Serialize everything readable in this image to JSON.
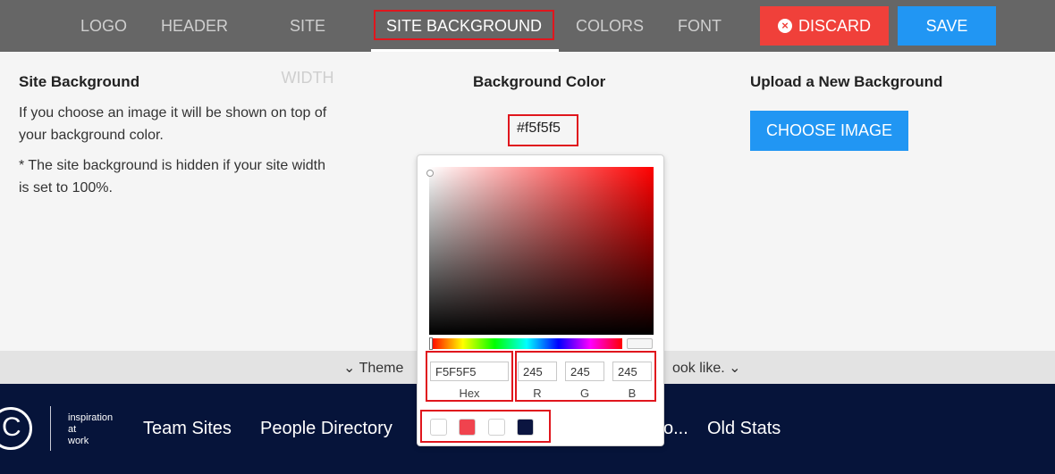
{
  "toolbar": {
    "tabs": [
      {
        "label": "LOGO"
      },
      {
        "label": "HEADER"
      },
      {
        "label": "SITE WIDTH"
      },
      {
        "label": "SITE BACKGROUND"
      },
      {
        "label": "COLORS"
      },
      {
        "label": "FONT"
      }
    ],
    "active_tab": "SITE BACKGROUND",
    "discard_label": "DISCARD",
    "save_label": "SAVE"
  },
  "site_background": {
    "title": "Site Background",
    "description": "If you choose an image it will be shown on top of your background color.",
    "note": "* The site background is hidden if your site width is set to 100%."
  },
  "background_color": {
    "title": "Background Color",
    "value": "#f5f5f5"
  },
  "upload": {
    "title": "Upload a New Background",
    "button_label": "CHOOSE IMAGE"
  },
  "color_picker": {
    "hex_value": "F5F5F5",
    "hex_label": "Hex",
    "r_value": "245",
    "g_value": "245",
    "b_value": "245",
    "r_label": "R",
    "g_label": "G",
    "b_label": "B",
    "swatches": [
      "#ffffff",
      "#f0434e",
      "#ffffff",
      "#0b1540"
    ]
  },
  "theme_bar": {
    "text_left": "Theme",
    "text_right": "ook like."
  },
  "nav": {
    "tagline": [
      "inspiration",
      "at",
      "work"
    ],
    "links": [
      {
        "label": "Team Sites"
      },
      {
        "label": "People Directory"
      },
      {
        "label": "o..."
      },
      {
        "label": "Old Stats"
      }
    ]
  },
  "colors": {
    "toolbar_bg": "#666666",
    "discard": "#f0403a",
    "save": "#2196f3",
    "nav_bg": "#06143a",
    "highlight": "#e0161d"
  }
}
